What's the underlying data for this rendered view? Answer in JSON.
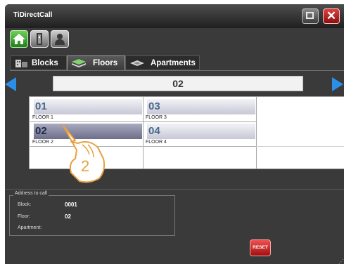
{
  "window": {
    "title": "TiDirectCall"
  },
  "titlebar": {
    "maximize_icon": "maximize-icon",
    "close_icon": "close-icon",
    "close_glyph": "✕"
  },
  "toolbar": {
    "home_icon": "home-icon",
    "door_icon": "door-icon",
    "user_icon": "user-icon"
  },
  "tabs": [
    {
      "label": "Blocks",
      "icon": "building-icon",
      "active": false
    },
    {
      "label": "Floors",
      "icon": "layers-icon",
      "active": true
    },
    {
      "label": "Apartments",
      "icon": "apartment-icon",
      "active": false
    }
  ],
  "selector": {
    "value": "02"
  },
  "floors": [
    {
      "number": "01",
      "label": "FLOOR 1",
      "selected": false
    },
    {
      "number": "03",
      "label": "FLOOR 3",
      "selected": false
    },
    {
      "number": "02",
      "label": "FLOOR 2",
      "selected": true
    },
    {
      "number": "04",
      "label": "FLOOR 4",
      "selected": false
    }
  ],
  "annotation": {
    "step": "2"
  },
  "address": {
    "legend": "Address to call",
    "block_label": "Block:",
    "block_value": "0001",
    "floor_label": "Floor:",
    "floor_value": "02",
    "apartment_label": "Apartment:",
    "apartment_value": ""
  },
  "reset": {
    "label": "RESET"
  },
  "colors": {
    "accent": "#2d8ee8",
    "reset": "#d42a2a",
    "close": "#c0201e",
    "home": "#3aa830"
  }
}
